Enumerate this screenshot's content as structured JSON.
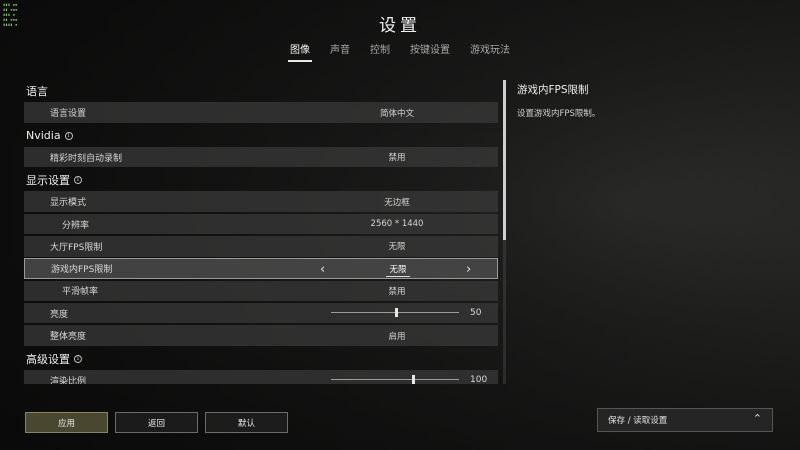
{
  "title": "设置",
  "tabs": [
    {
      "label": "图像",
      "active": true
    },
    {
      "label": "声音",
      "active": false
    },
    {
      "label": "控制",
      "active": false
    },
    {
      "label": "按键设置",
      "active": false
    },
    {
      "label": "游戏玩法",
      "active": false
    }
  ],
  "sections": {
    "language": {
      "header": "语言",
      "rows": [
        {
          "label": "语言设置",
          "value": "简体中文"
        }
      ]
    },
    "nvidia": {
      "header": "Nvidia",
      "rows": [
        {
          "label": "精彩时刻自动录制",
          "value": "禁用"
        }
      ]
    },
    "display": {
      "header": "显示设置",
      "rows": [
        {
          "label": "显示模式",
          "value": "无边框"
        },
        {
          "label": "分辨率",
          "value": "2560 * 1440"
        },
        {
          "label": "大厅FPS限制",
          "value": "无限"
        },
        {
          "label": "游戏内FPS限制",
          "value": "无限"
        },
        {
          "label": "平滑帧率",
          "value": "禁用"
        },
        {
          "label": "亮度",
          "value": "50",
          "slider": 0.5
        },
        {
          "label": "整体亮度",
          "value": "启用"
        }
      ]
    },
    "advanced": {
      "header": "高级设置",
      "rows": [
        {
          "label": "渲染比例",
          "value": "100",
          "slider": 0.63
        }
      ]
    }
  },
  "description": {
    "title": "游戏内FPS限制",
    "text": "设置游戏内FPS限制。"
  },
  "buttons": {
    "apply": "应用",
    "back": "返回",
    "default": "默认"
  },
  "save_load": "保存 / 读取设置",
  "colors": {
    "accent_apply": "#4a4731",
    "row_bg": "#3a3a3a",
    "selected_border": "#9a9a9a"
  }
}
